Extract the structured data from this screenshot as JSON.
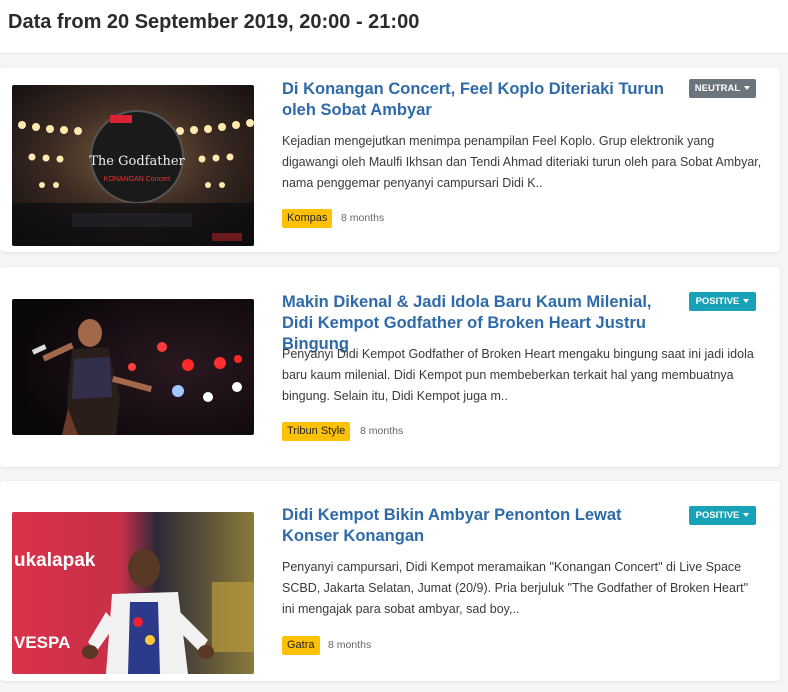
{
  "header": {
    "title": "Data from 20 September 2019, 20:00 - 21:00"
  },
  "articles": [
    {
      "title": "Di Konangan Concert, Feel Koplo Diteriaki Turun oleh Sobat Ambyar",
      "sentiment": "NEUTRAL",
      "description": "Kejadian mengejutkan menimpa penampilan Feel Koplo. Grup elektronik yang digawangi oleh Maulfi Ikhsan dan Tendi Ahmad diteriaki turun oleh para Sobat Ambyar, nama penggemar penyanyi campursari Didi K..",
      "source": "Kompas",
      "time": "8 months",
      "image_text": "The Godfather",
      "image_subtext": "KONANGAN Concert"
    },
    {
      "title": "Makin Dikenal & Jadi Idola Baru Kaum Milenial, Didi Kempot Godfather of Broken Heart Justru Bingung",
      "sentiment": "POSITIVE",
      "description": "Penyanyi Didi Kempot Godfather of Broken Heart mengaku bingung saat ini jadi idola baru kaum milenial. Didi Kempot pun membeberkan terkait hal yang membuatnya bingung. Selain itu, Didi Kempot juga m..",
      "source": "Tribun Style",
      "time": "8 months"
    },
    {
      "title": "Didi Kempot Bikin Ambyar Penonton Lewat Konser Konangan",
      "sentiment": "POSITIVE",
      "description": "Penyanyi campursari, Didi Kempot meramaikan \"Konangan Concert\" di Live Space SCBD, Jakarta Selatan, Jumat (20/9). Pria berjuluk \"The Godfather of Broken Heart\" ini mengajak para sobat ambyar, sad boy,..",
      "source": "Gatra",
      "time": "8 months",
      "image_text": "ukalapak",
      "image_subtext": "VESPA"
    }
  ],
  "colors": {
    "title_link": "#2f6aa8",
    "neutral_badge": "#6c757d",
    "positive_badge": "#17a2b8",
    "source_tag": "#ffc107"
  }
}
